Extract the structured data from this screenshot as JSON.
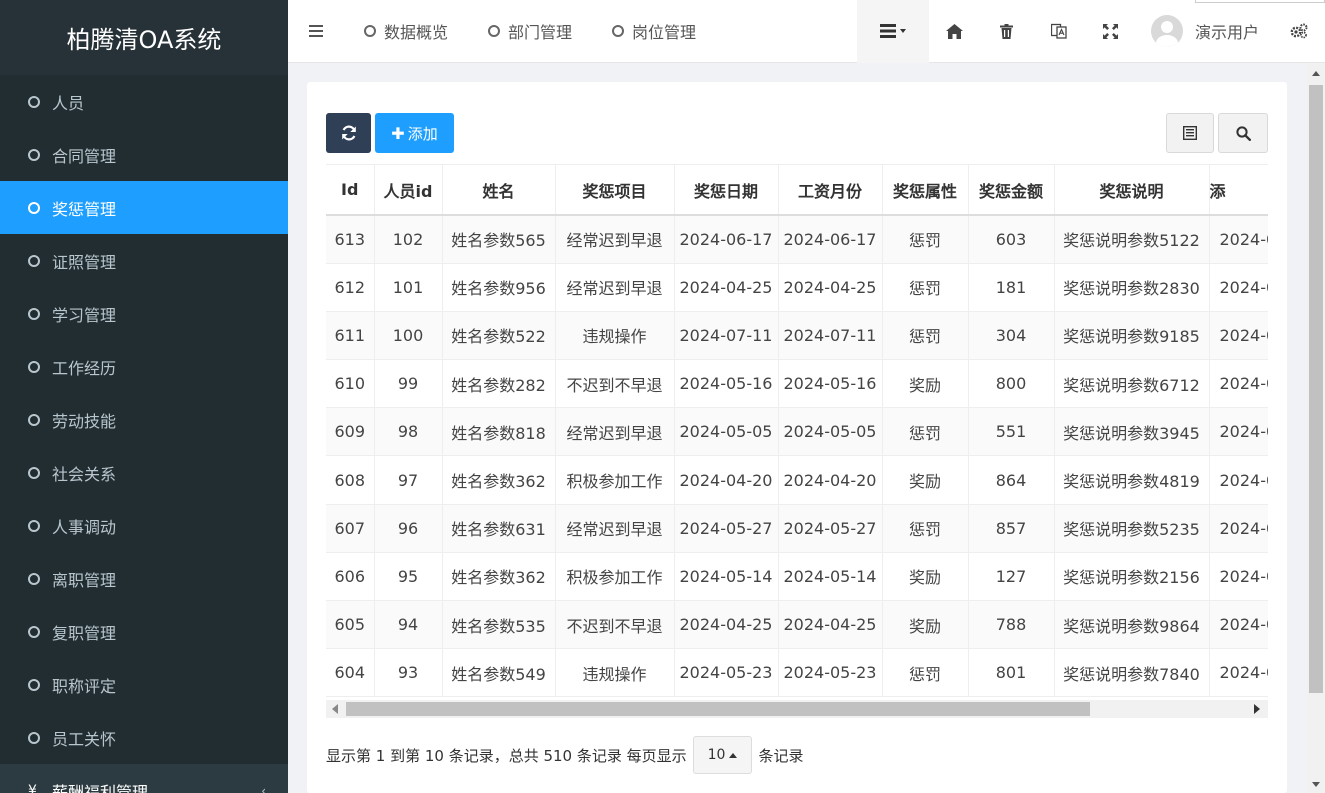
{
  "app": {
    "title": "柏腾清OA系统"
  },
  "sidebar": {
    "items": [
      {
        "label": "人员"
      },
      {
        "label": "合同管理"
      },
      {
        "label": "奖惩管理",
        "active": true
      },
      {
        "label": "证照管理"
      },
      {
        "label": "学习管理"
      },
      {
        "label": "工作经历"
      },
      {
        "label": "劳动技能"
      },
      {
        "label": "社会关系"
      },
      {
        "label": "人事调动"
      },
      {
        "label": "离职管理"
      },
      {
        "label": "复职管理"
      },
      {
        "label": "职称评定"
      },
      {
        "label": "员工关怀"
      }
    ],
    "group": {
      "icon": "¥",
      "label": "薪酬福利管理"
    }
  },
  "topbar": {
    "tabs": [
      {
        "label": "数据概览"
      },
      {
        "label": "部门管理"
      },
      {
        "label": "岗位管理"
      }
    ],
    "user": {
      "name": "演示用户"
    }
  },
  "toolbar": {
    "add_label": "添加"
  },
  "table": {
    "columns": [
      "Id",
      "人员id",
      "姓名",
      "奖惩项目",
      "奖惩日期",
      "工资月份",
      "奖惩属性",
      "奖惩金额",
      "奖惩说明",
      "添"
    ],
    "rows": [
      [
        "613",
        "102",
        "姓名参数565",
        "经常迟到早退",
        "2024-06-17",
        "2024-06-17",
        "惩罚",
        "603",
        "奖惩说明参数5122",
        "2024-0"
      ],
      [
        "612",
        "101",
        "姓名参数956",
        "经常迟到早退",
        "2024-04-25",
        "2024-04-25",
        "惩罚",
        "181",
        "奖惩说明参数2830",
        "2024-0"
      ],
      [
        "611",
        "100",
        "姓名参数522",
        "违规操作",
        "2024-07-11",
        "2024-07-11",
        "惩罚",
        "304",
        "奖惩说明参数9185",
        "2024-0"
      ],
      [
        "610",
        "99",
        "姓名参数282",
        "不迟到不早退",
        "2024-05-16",
        "2024-05-16",
        "奖励",
        "800",
        "奖惩说明参数6712",
        "2024-0"
      ],
      [
        "609",
        "98",
        "姓名参数818",
        "经常迟到早退",
        "2024-05-05",
        "2024-05-05",
        "惩罚",
        "551",
        "奖惩说明参数3945",
        "2024-0"
      ],
      [
        "608",
        "97",
        "姓名参数362",
        "积极参加工作",
        "2024-04-20",
        "2024-04-20",
        "奖励",
        "864",
        "奖惩说明参数4819",
        "2024-0"
      ],
      [
        "607",
        "96",
        "姓名参数631",
        "经常迟到早退",
        "2024-05-27",
        "2024-05-27",
        "惩罚",
        "857",
        "奖惩说明参数5235",
        "2024-0"
      ],
      [
        "606",
        "95",
        "姓名参数362",
        "积极参加工作",
        "2024-05-14",
        "2024-05-14",
        "奖励",
        "127",
        "奖惩说明参数2156",
        "2024-0"
      ],
      [
        "605",
        "94",
        "姓名参数535",
        "不迟到不早退",
        "2024-04-25",
        "2024-04-25",
        "奖励",
        "788",
        "奖惩说明参数9864",
        "2024-0"
      ],
      [
        "604",
        "93",
        "姓名参数549",
        "违规操作",
        "2024-05-23",
        "2024-05-23",
        "惩罚",
        "801",
        "奖惩说明参数7840",
        "2024-0"
      ]
    ]
  },
  "pagination": {
    "summary": "显示第 1 到第 10 条记录，总共 510 条记录 每页显示",
    "page_size": "10",
    "suffix": "条记录"
  },
  "colors": {
    "accent": "#1e9fff",
    "sidebar": "#222d32",
    "dark_button": "#2f4056"
  }
}
